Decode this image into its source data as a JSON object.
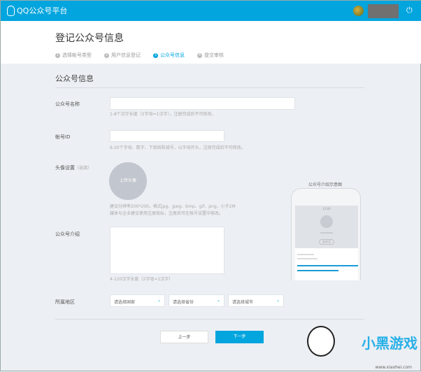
{
  "header": {
    "logo": "QQ公众号平台",
    "power_icon": "power-icon"
  },
  "page": {
    "title": "登记公众号信息"
  },
  "steps": [
    {
      "n": "1",
      "label": "选择帐号类型"
    },
    {
      "n": "2",
      "label": "用户信息登记"
    },
    {
      "n": "3",
      "label": "公众号信息",
      "active": true
    },
    {
      "n": "4",
      "label": "提交审核"
    }
  ],
  "form": {
    "section_title": "公众号信息",
    "name": {
      "label": "公众号名称",
      "value": "",
      "hint": "1-8个汉字长度（2字母=1汉字），注册完成后不可修改。"
    },
    "account_id": {
      "label": "帐号ID",
      "value": "",
      "hint": "6-20个字母、数字、下划线和减号，以字母开头，注册完成后不可修改。"
    },
    "avatar": {
      "label": "头像设置",
      "optional": "（选填）",
      "upload": "上传头像",
      "hint1": "建议分辨率200*200，格式jpg、jpeg、bmp、gif、png，小于2M",
      "hint2": "媒体与企业建议使用注册商标，注册后可在帐号设置中修改。"
    },
    "intro": {
      "label": "公众号介绍",
      "value": "",
      "hint": "4-120汉字长度（2字母=1汉字）"
    },
    "region": {
      "label": "所属地区",
      "country": "请选择国家",
      "province": "请选择省份",
      "city": "请选择城市"
    }
  },
  "preview": {
    "label": "公众号介绍示意图",
    "time": "12:00",
    "follow": "加关注"
  },
  "buttons": {
    "prev": "上一步",
    "next": "下一步"
  },
  "watermark": {
    "text": "小黑游戏",
    "url": "www.xiaohei.com"
  },
  "colors": {
    "accent": "#02a5de"
  }
}
